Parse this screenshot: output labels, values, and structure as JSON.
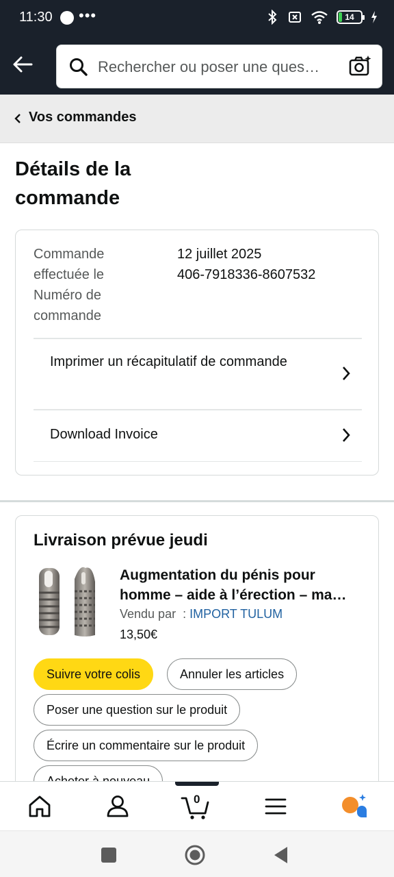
{
  "status_bar": {
    "time": "11:30",
    "more": "•••",
    "battery": "14"
  },
  "header": {
    "search_placeholder": "Rechercher ou poser une ques…"
  },
  "breadcrumb": {
    "label": "Vos commandes"
  },
  "page": {
    "title": "Détails de la commande"
  },
  "order_info": {
    "placed_label": "Commande effectuée le",
    "number_label": "Numéro de commande",
    "placed_value": "12 juillet 2025",
    "number_value": "406-7918336-8607532"
  },
  "links": {
    "print_summary": "Imprimer un récapitulatif de commande",
    "download_invoice": "Download Invoice"
  },
  "shipment": {
    "title": "Livraison prévue jeudi",
    "product_title": "Augmentation du pénis pour homme – aide à l’érection – ma…",
    "sold_by_label": "Vendu par  :",
    "seller_name": "IMPORT TULUM",
    "price": "13,50€"
  },
  "actions": {
    "track": "Suivre votre colis",
    "cancel": "Annuler les articles",
    "question": "Poser une question sur le produit",
    "review": "Écrire un commentaire sur le produit",
    "buy_again": "Acheter à nouveau"
  },
  "nav": {
    "cart_count": "0"
  },
  "colors": {
    "header_bg": "#1a212b",
    "primary_button": "#ffd814",
    "link": "#2162a1"
  }
}
